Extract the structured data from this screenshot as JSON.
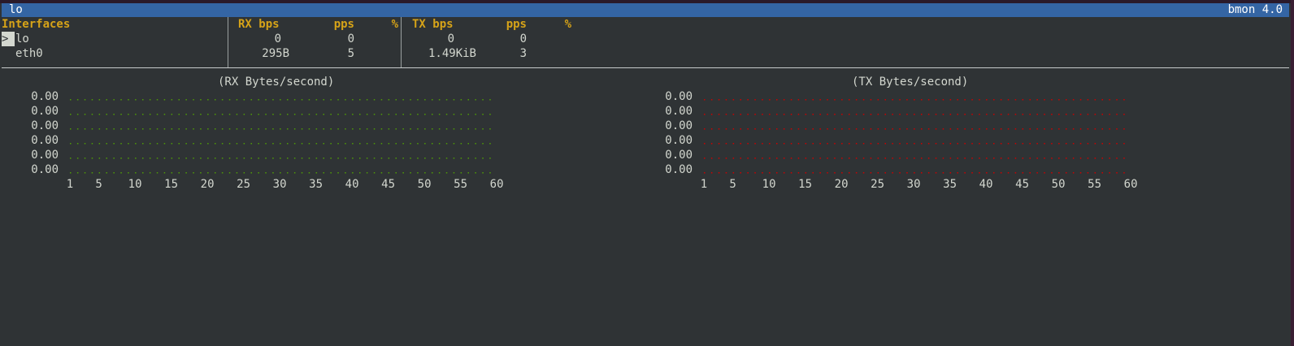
{
  "window": {
    "title_left": "lo",
    "title_right": "bmon 4.0"
  },
  "colors": {
    "titlebar": "#3465a4",
    "background": "#2f3335",
    "header": "#d6a318",
    "rx_dots": "#4e9a06",
    "tx_dots": "#cc0000",
    "text": "#d3d7cf"
  },
  "interfaces": {
    "headers": {
      "interfaces": "Interfaces",
      "rx_bps": "RX bps",
      "rx_pps": "pps",
      "rx_pct": "%",
      "tx_bps": "TX bps",
      "tx_pps": "pps",
      "tx_pct": "%"
    },
    "cursor": ">",
    "rows": [
      {
        "name": "lo",
        "rx_bps": "0",
        "rx_pps": "0",
        "tx_bps": "0",
        "tx_pps": "0",
        "selected": true
      },
      {
        "name": "eth0",
        "rx_bps": "295B",
        "rx_pps": "5",
        "tx_bps": "1.49KiB",
        "tx_pps": "3",
        "selected": false
      }
    ]
  },
  "graphs": {
    "rx": {
      "title": "(RX Bytes/second)",
      "y_labels": [
        "0.00",
        "0.00",
        "0.00",
        "0.00",
        "0.00",
        "0.00"
      ],
      "x_ticks": [
        "1",
        "5",
        "10",
        "15",
        "20",
        "25",
        "30",
        "35",
        "40",
        "45",
        "50",
        "55",
        "60"
      ]
    },
    "tx": {
      "title": "(TX Bytes/second)",
      "y_labels": [
        "0.00",
        "0.00",
        "0.00",
        "0.00",
        "0.00",
        "0.00"
      ],
      "x_ticks": [
        "1",
        "5",
        "10",
        "15",
        "20",
        "25",
        "30",
        "35",
        "40",
        "45",
        "50",
        "55",
        "60"
      ]
    }
  }
}
